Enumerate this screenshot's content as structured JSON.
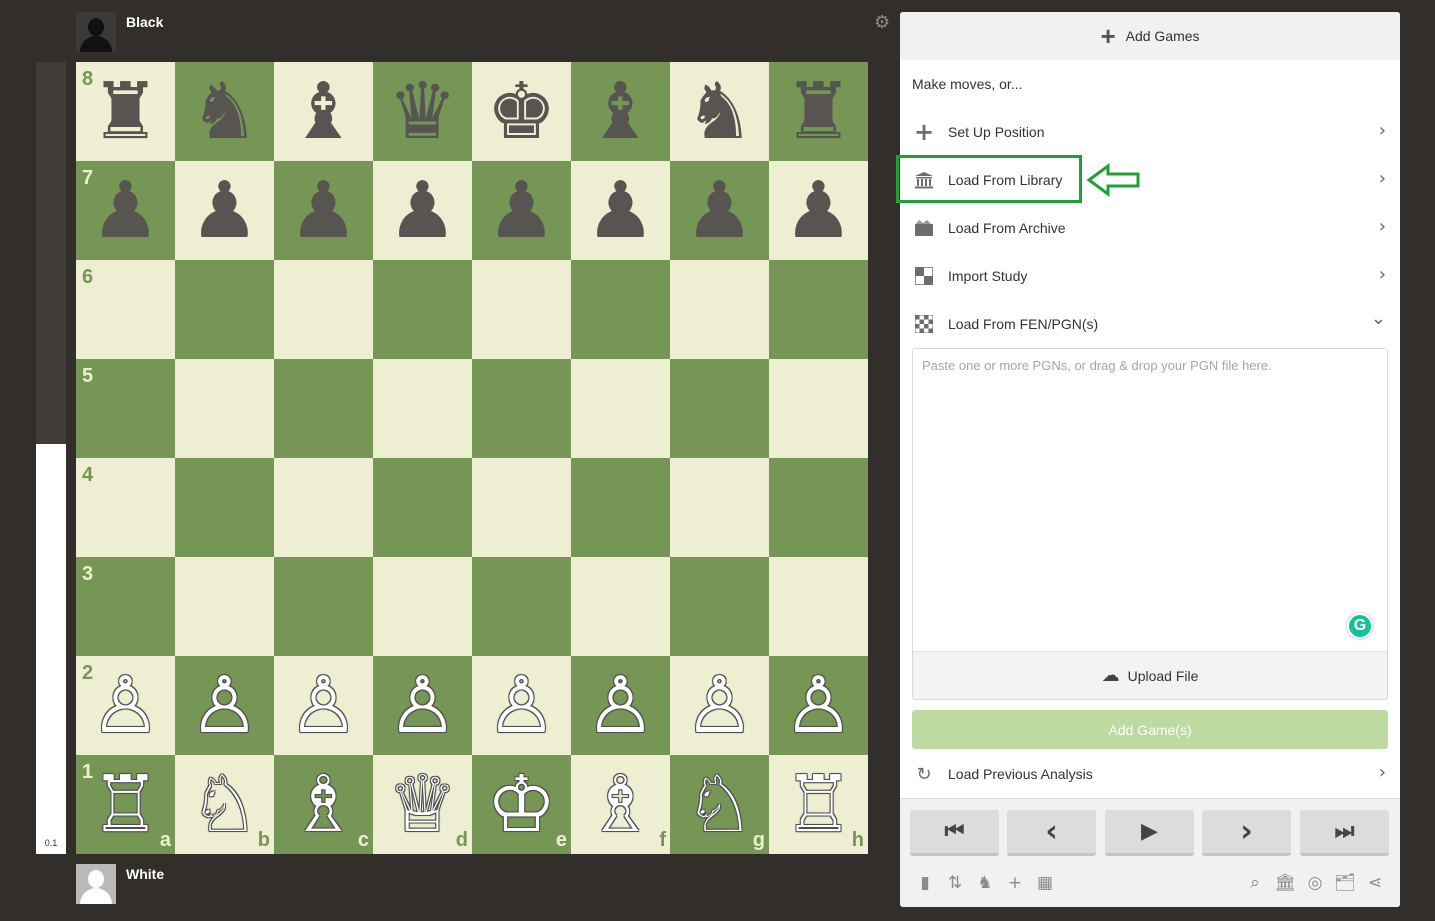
{
  "players": {
    "top": {
      "name": "Black"
    },
    "bottom": {
      "name": "White"
    }
  },
  "eval": {
    "text": "0.1",
    "black_fraction": 0.482
  },
  "board": {
    "ranks": [
      "8",
      "7",
      "6",
      "5",
      "4",
      "3",
      "2",
      "1"
    ],
    "files": [
      "a",
      "b",
      "c",
      "d",
      "e",
      "f",
      "g",
      "h"
    ],
    "position": [
      [
        "♜",
        "♞",
        "♝",
        "♛",
        "♚",
        "♝",
        "♞",
        "♜"
      ],
      [
        "♟",
        "♟",
        "♟",
        "♟",
        "♟",
        "♟",
        "♟",
        "♟"
      ],
      [
        "",
        "",
        "",
        "",
        "",
        "",
        "",
        ""
      ],
      [
        "",
        "",
        "",
        "",
        "",
        "",
        "",
        ""
      ],
      [
        "",
        "",
        "",
        "",
        "",
        "",
        "",
        ""
      ],
      [
        "",
        "",
        "",
        "",
        "",
        "",
        "",
        ""
      ],
      [
        "♙",
        "♙",
        "♙",
        "♙",
        "♙",
        "♙",
        "♙",
        "♙"
      ],
      [
        "♖",
        "♘",
        "♗",
        "♕",
        "♔",
        "♗",
        "♘",
        "♖"
      ]
    ],
    "colors": {
      "light": "#eeeed2",
      "dark": "#769656"
    }
  },
  "settings_icon": "⚙",
  "panel": {
    "header": {
      "label": "Add Games",
      "icon": "+"
    },
    "hint": "Make moves, or...",
    "options": [
      {
        "icon": "+",
        "label": "Set Up Position",
        "chevron": "›"
      },
      {
        "icon": "🏛",
        "label": "Load From Library",
        "chevron": "›"
      },
      {
        "icon": "🗂",
        "label": "Load From Archive",
        "chevron": "›"
      },
      {
        "icon": "▚",
        "label": "Import Study",
        "chevron": "›"
      },
      {
        "icon": "▦",
        "label": "Load From FEN/PGN(s)",
        "chevron": "⌄"
      }
    ],
    "pgn_placeholder": "Paste one or more PGNs, or drag & drop your PGN file here.",
    "grammarly": "G",
    "upload": {
      "label": "Upload File",
      "icon": "☁"
    },
    "add_games_button": "Add Game(s)",
    "previous_analysis": {
      "icon": "↻",
      "label": "Load Previous Analysis",
      "chevron": "›"
    },
    "nav_buttons": [
      "⏮",
      "‹",
      "▶",
      "›",
      "⏭"
    ],
    "tools_left": [
      "▮",
      "⇅",
      "♞",
      "+",
      "▦"
    ],
    "tools_right": [
      "⌕",
      "🏛",
      "◎",
      "🗂",
      "⋖"
    ]
  },
  "highlight_color": "#21a038"
}
